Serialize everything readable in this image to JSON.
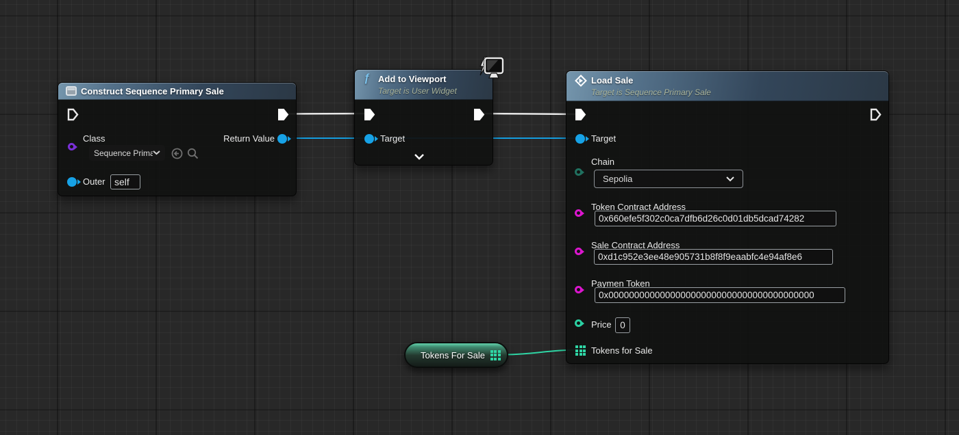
{
  "colors": {
    "exec_pin": "#e8e8e8",
    "object_pin": "#17a2e6",
    "class_pin": "#7a30d8",
    "enum_pin": "#20705f",
    "string_pin": "#db16ce",
    "int_pin": "#2bd0a2",
    "array_pin": "#2fd6a5",
    "wire_object": "#149ee0",
    "wire_array": "#2fd6a5",
    "header_blue": "#54718a",
    "subtitle_text": "#a9b49c"
  },
  "nodes": {
    "construct": {
      "title": "Construct Sequence Primary Sale",
      "class_label": "Class",
      "class_value": "Sequence Prima",
      "return_label": "Return Value",
      "outer_label": "Outer",
      "outer_value": "self"
    },
    "viewport": {
      "title": "Add to Viewport",
      "subtitle": "Target is User Widget",
      "target_label": "Target"
    },
    "load": {
      "title": "Load Sale",
      "subtitle": "Target is Sequence Primary Sale",
      "target_label": "Target",
      "chain_label": "Chain",
      "chain_value": "Sepolia",
      "token_label": "Token Contract Address",
      "token_value": "0x660efe5f302c0ca7dfb6d26c0d01db5dcad74282",
      "sale_label": "Sale Contract Address",
      "sale_value": "0xd1c952e3ee48e905731b8f8f9eaabfc4e94af8e6",
      "payment_label": "Paymen Token",
      "payment_value": "0x0000000000000000000000000000000000000000",
      "price_label": "Price",
      "price_value": "0",
      "tokens_label": "Tokens for Sale"
    },
    "tokens_var": {
      "title": "Tokens For Sale"
    }
  }
}
